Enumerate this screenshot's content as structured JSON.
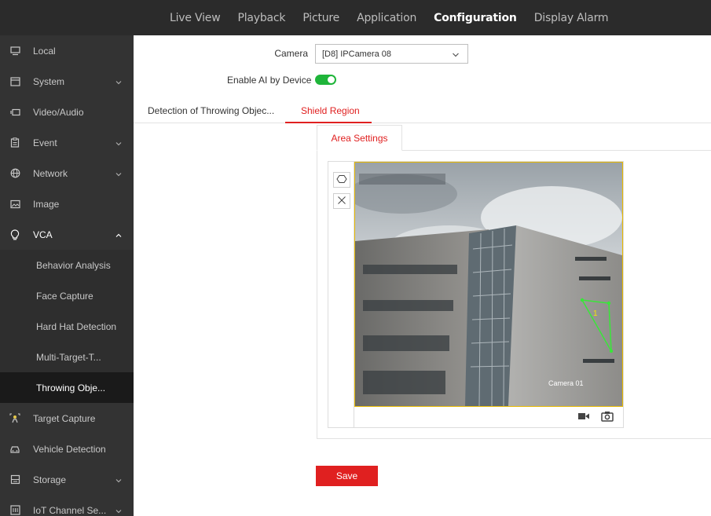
{
  "topnav": {
    "tabs": [
      {
        "label": "Live View",
        "active": false
      },
      {
        "label": "Playback",
        "active": false
      },
      {
        "label": "Picture",
        "active": false
      },
      {
        "label": "Application",
        "active": false
      },
      {
        "label": "Configuration",
        "active": true
      },
      {
        "label": "Display Alarm",
        "active": false
      }
    ]
  },
  "sidebar": {
    "items": [
      {
        "label": "Local",
        "icon": "monitor-icon"
      },
      {
        "label": "System",
        "icon": "system-icon"
      },
      {
        "label": "Video/Audio",
        "icon": "video-icon"
      },
      {
        "label": "Event",
        "icon": "event-icon"
      },
      {
        "label": "Network",
        "icon": "globe-icon"
      },
      {
        "label": "Image",
        "icon": "image-icon"
      },
      {
        "label": "VCA",
        "icon": "lightbulb-icon"
      },
      {
        "label": "Target Capture",
        "icon": "target-icon"
      },
      {
        "label": "Vehicle Detection",
        "icon": "car-icon"
      },
      {
        "label": "Storage",
        "icon": "storage-icon"
      },
      {
        "label": "IoT Channel Se...",
        "icon": "iot-icon"
      }
    ],
    "vca_subitems": [
      {
        "label": "Behavior Analysis"
      },
      {
        "label": "Face Capture"
      },
      {
        "label": "Hard Hat Detection"
      },
      {
        "label": "Multi-Target-T..."
      },
      {
        "label": "Throwing Obje...",
        "active": true
      }
    ]
  },
  "form": {
    "camera_label": "Camera",
    "camera_value": "[D8] IPCamera 08",
    "ai_label": "Enable AI by Device",
    "ai_enabled": true
  },
  "subtabs": [
    {
      "label": "Detection of Throwing Objec...",
      "active": false
    },
    {
      "label": "Shield Region",
      "active": true
    }
  ],
  "panel": {
    "tab_label": "Area Settings"
  },
  "video": {
    "osd_camera": "Camera 01",
    "region_number": "1"
  },
  "actions": {
    "save_label": "Save"
  },
  "colors": {
    "accent": "#e02020",
    "toggle_on": "#1fb53a",
    "sidebar_bg": "#333333",
    "topnav_bg": "#2b2b2b",
    "region": "#39e639"
  }
}
